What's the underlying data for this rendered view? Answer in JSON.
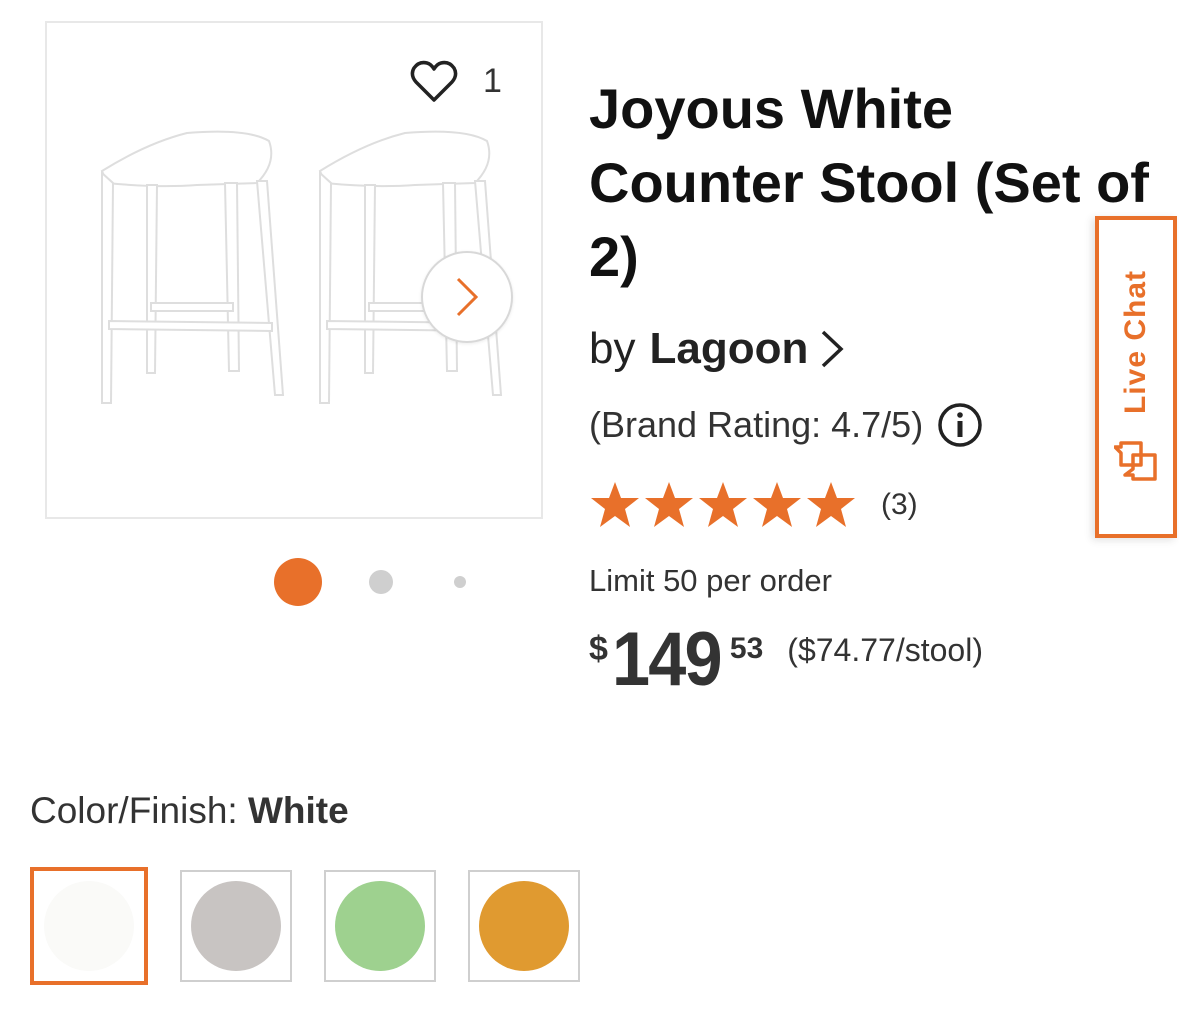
{
  "product": {
    "title": "Joyous White Counter Stool (Set of 2)",
    "by_label": "by",
    "brand": "Lagoon",
    "brand_rating": "(Brand Rating: 4.7/5)",
    "rating_stars": 5,
    "review_count": "(3)",
    "limit": "Limit 50 per order",
    "price": {
      "currency": "$",
      "dollars": "149",
      "cents": "53",
      "unit_price": "($74.77/stool)"
    }
  },
  "gallery": {
    "favorite_count": "1",
    "active_index": 0,
    "dot_count": 3
  },
  "live_chat": {
    "label": "Live Chat"
  },
  "color": {
    "label": "Color/Finish:",
    "selected": "White",
    "swatches": [
      {
        "name": "White",
        "color": "#fafaf8",
        "selected": true
      },
      {
        "name": "Gray",
        "color": "#c8c4c2",
        "selected": false
      },
      {
        "name": "Green",
        "color": "#9ed18f",
        "selected": false
      },
      {
        "name": "Orange",
        "color": "#e09a30",
        "selected": false
      }
    ]
  },
  "colors": {
    "accent": "#e8702a",
    "text": "#222222",
    "border": "#e8e8e8"
  }
}
